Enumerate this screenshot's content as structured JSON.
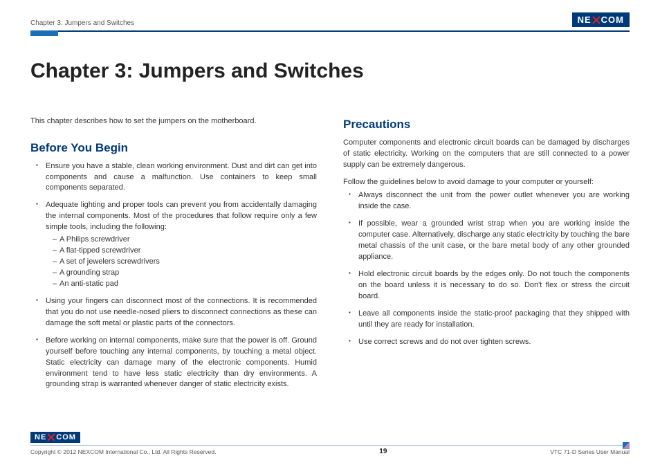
{
  "header": {
    "breadcrumb": "Chapter 3: Jumpers and Switches",
    "logo_text_pre": "NE",
    "logo_text_post": "COM"
  },
  "chapter_title": "Chapter 3: Jumpers and Switches",
  "left": {
    "intro": "This chapter describes how to set the jumpers on the motherboard.",
    "section_title": "Before You Begin",
    "bullets": [
      {
        "text": "Ensure you have a stable, clean working environment. Dust and dirt can get into components and cause a malfunction. Use containers to keep small components separated."
      },
      {
        "text": "Adequate lighting and proper tools can prevent you from accidentally damaging the internal components. Most of the procedures that follow require only a few simple tools, including the following:",
        "sub": [
          "A Philips screwdriver",
          "A flat-tipped screwdriver",
          "A set of jewelers screwdrivers",
          "A grounding strap",
          "An anti-static pad"
        ]
      },
      {
        "text": "Using your fingers can disconnect most of the connections. It is recommended that you do not use needle-nosed pliers to disconnect connections as these can damage the soft metal or plastic parts of the connectors."
      },
      {
        "text": "Before working on internal components, make sure that the power is off. Ground yourself before touching any internal components, by touching a metal object. Static electricity can damage many of the electronic components. Humid environment tend to have less static electricity than dry environments. A grounding strap is warranted whenever danger of static electricity exists."
      }
    ]
  },
  "right": {
    "section_title": "Precautions",
    "intro": "Computer components and electronic circuit boards can be damaged by discharges of static electricity. Working on the computers that are still connected to a power supply can be extremely dangerous.",
    "follow": "Follow the guidelines below to avoid damage to your computer or yourself:",
    "bullets": [
      "Always disconnect the unit from the power outlet whenever you are working inside the case.",
      "If possible, wear a grounded wrist strap when you are working inside the computer case. Alternatively, discharge any static electricity by touching the bare metal chassis of the unit case, or the bare metal body of any other grounded appliance.",
      "Hold electronic circuit boards by the edges only. Do not touch the components on the board unless it is necessary to do so. Don't flex or stress the circuit board.",
      "Leave all components inside the static-proof packaging that they shipped with until they are ready for installation.",
      "Use correct screws and do not over tighten screws."
    ]
  },
  "footer": {
    "copyright": "Copyright © 2012 NEXCOM International Co., Ltd. All Rights Reserved.",
    "page_number": "19",
    "doc_title": "VTC 71-D Series User Manual",
    "logo_text_pre": "NE",
    "logo_text_post": "COM"
  }
}
